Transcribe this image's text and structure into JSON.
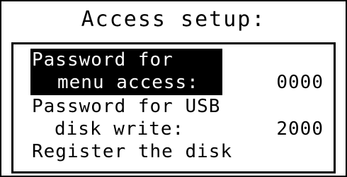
{
  "screen": {
    "title": "Access setup:",
    "menu": {
      "items": [
        {
          "label_line1": "Password for",
          "label_line2": "menu access:",
          "value": "0000",
          "selected": true
        },
        {
          "label_line1": "Password for USB",
          "label_line2": "disk write:",
          "value": "2000",
          "selected": false
        },
        {
          "label_line1": "Register the disk",
          "selected": false
        }
      ]
    }
  },
  "colors": {
    "foreground": "#000000",
    "background": "#ffffff",
    "highlight_background": "#000000",
    "highlight_text": "#ffffff"
  }
}
